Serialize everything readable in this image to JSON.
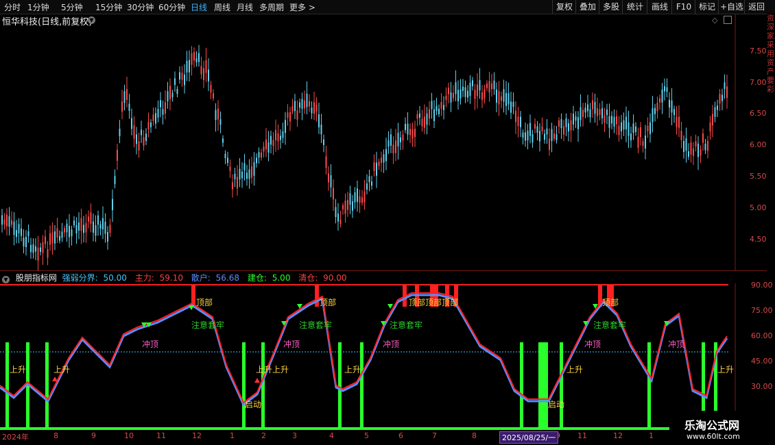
{
  "toolbar": {
    "periods": [
      "分时",
      "1分钟",
      "5分钟",
      "15分钟",
      "30分钟",
      "60分钟",
      "日线",
      "周线",
      "月线",
      "多周期",
      "更多 >"
    ],
    "active_period": "日线",
    "right_buttons": [
      "复权",
      "叠加",
      "多股",
      "统计",
      "画线",
      "F10",
      "标记",
      "+自选",
      "返回"
    ]
  },
  "chart": {
    "title": "恒华科技(日线,前复权)",
    "price_ticks": [
      "7.50",
      "7.00",
      "6.50",
      "6.00",
      "5.50",
      "5.00",
      "4.50"
    ]
  },
  "indicator": {
    "name": "股朋指标网",
    "items": [
      {
        "label": "强弱分界:",
        "value": "50.00",
        "color": "#43c6ff"
      },
      {
        "label": "主力:",
        "value": "59.10",
        "color": "#ff4040"
      },
      {
        "label": "散户:",
        "value": "56.68",
        "color": "#5b8cff"
      },
      {
        "label": "建仓:",
        "value": "5.00",
        "color": "#2bff2b"
      },
      {
        "label": "清仓:",
        "value": "90.00",
        "color": "#ff4040"
      }
    ],
    "ticks": [
      "90.00",
      "75.00",
      "60.00",
      "45.00",
      "30.00"
    ],
    "signals": [
      {
        "text": "上升",
        "color": "#ffd23c"
      },
      {
        "text": "上升",
        "color": "#ffd23c"
      },
      {
        "text": "冲顶",
        "color": "#ff5cc8"
      },
      {
        "text": "顶部",
        "color": "#ffd23c"
      },
      {
        "text": "注意套牢",
        "color": "#2bd02b"
      },
      {
        "text": "上升上升",
        "color": "#ffd23c"
      },
      {
        "text": "启动",
        "color": "#ffd23c"
      },
      {
        "text": "冲顶",
        "color": "#ff5cc8"
      },
      {
        "text": "顶部",
        "color": "#ffd23c"
      },
      {
        "text": "注意套牢",
        "color": "#2bd02b"
      },
      {
        "text": "上升",
        "color": "#ffd23c"
      },
      {
        "text": "冲顶",
        "color": "#ff5cc8"
      },
      {
        "text": "注意套牢",
        "color": "#2bd02b"
      },
      {
        "text": "顶部顶部顶部",
        "color": "#ffd23c"
      },
      {
        "text": "启动",
        "color": "#ffd23c"
      },
      {
        "text": "上升",
        "color": "#ffd23c"
      },
      {
        "text": "冲顶",
        "color": "#ff5cc8"
      },
      {
        "text": "顶部",
        "color": "#ffd23c"
      },
      {
        "text": "注意套牢",
        "color": "#2bd02b"
      },
      {
        "text": "冲顶",
        "color": "#ff5cc8"
      },
      {
        "text": "上升",
        "color": "#ffd23c"
      }
    ]
  },
  "xaxis": {
    "labels": [
      "2024年",
      "8",
      "9",
      "10",
      "11",
      "12",
      "1",
      "2",
      "3",
      "4",
      "5",
      "6",
      "7",
      "8",
      "9",
      "11",
      "12",
      "1"
    ],
    "current_date": "2025/08/25/一"
  },
  "watermark": {
    "title": "乐淘公式网",
    "url": "www.60lt.com"
  },
  "right_strip": "资深家采用资产要彩"
}
